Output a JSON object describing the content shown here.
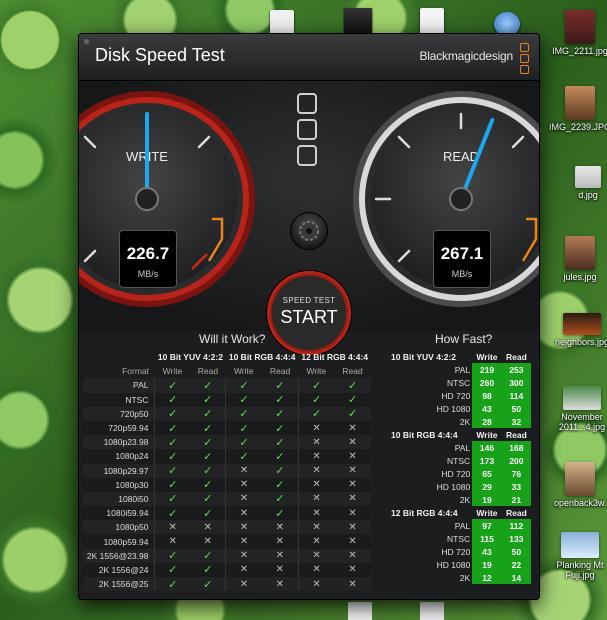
{
  "window": {
    "title": "Disk Speed Test",
    "brand": "Blackmagicdesign",
    "accent": "#e8831c"
  },
  "write_gauge": {
    "label": "WRITE",
    "value": "226.7",
    "unit": "MB/s",
    "needle_fraction": 0.5
  },
  "read_gauge": {
    "label": "READ",
    "value": "267.1",
    "unit": "MB/s",
    "needle_fraction": 0.58
  },
  "start_button": {
    "small": "SPEED TEST",
    "big": "START"
  },
  "will_it_work": {
    "title": "Will it Work?",
    "groups": [
      "10 Bit YUV 4:2:2",
      "10 Bit RGB 4:4:4",
      "12 Bit RGB 4:4:4"
    ],
    "format_header": "Format",
    "write_label": "Write",
    "read_label": "Read",
    "rows": [
      {
        "format": "PAL",
        "checks": [
          1,
          1,
          1,
          1,
          1,
          1
        ]
      },
      {
        "format": "NTSC",
        "checks": [
          1,
          1,
          1,
          1,
          1,
          1
        ]
      },
      {
        "format": "720p50",
        "checks": [
          1,
          1,
          1,
          1,
          1,
          1
        ]
      },
      {
        "format": "720p59.94",
        "checks": [
          1,
          1,
          1,
          1,
          0,
          0
        ]
      },
      {
        "format": "1080p23.98",
        "checks": [
          1,
          1,
          1,
          1,
          0,
          0
        ]
      },
      {
        "format": "1080p24",
        "checks": [
          1,
          1,
          1,
          1,
          0,
          0
        ]
      },
      {
        "format": "1080p29.97",
        "checks": [
          1,
          1,
          0,
          1,
          0,
          0
        ]
      },
      {
        "format": "1080p30",
        "checks": [
          1,
          1,
          0,
          1,
          0,
          0
        ]
      },
      {
        "format": "1080i50",
        "checks": [
          1,
          1,
          0,
          1,
          0,
          0
        ]
      },
      {
        "format": "1080i59.94",
        "checks": [
          1,
          1,
          0,
          1,
          0,
          0
        ]
      },
      {
        "format": "1080p50",
        "checks": [
          0,
          0,
          0,
          0,
          0,
          0
        ]
      },
      {
        "format": "1080p59.94",
        "checks": [
          0,
          0,
          0,
          0,
          0,
          0
        ]
      },
      {
        "format": "2K 1556@23.98",
        "checks": [
          1,
          1,
          0,
          0,
          0,
          0
        ]
      },
      {
        "format": "2K 1556@24",
        "checks": [
          1,
          1,
          0,
          0,
          0,
          0
        ]
      },
      {
        "format": "2K 1556@25",
        "checks": [
          1,
          1,
          0,
          0,
          0,
          0
        ]
      }
    ]
  },
  "how_fast": {
    "title": "How Fast?",
    "write_label": "Write",
    "read_label": "Read",
    "sections": [
      {
        "name": "10 Bit YUV 4:2:2",
        "rows": [
          {
            "format": "PAL",
            "write": "219",
            "read": "253"
          },
          {
            "format": "NTSC",
            "write": "260",
            "read": "300"
          },
          {
            "format": "HD 720",
            "write": "98",
            "read": "114"
          },
          {
            "format": "HD 1080",
            "write": "43",
            "read": "50"
          },
          {
            "format": "2K",
            "write": "28",
            "read": "32"
          }
        ]
      },
      {
        "name": "10 Bit RGB 4:4:4",
        "rows": [
          {
            "format": "PAL",
            "write": "146",
            "read": "168"
          },
          {
            "format": "NTSC",
            "write": "173",
            "read": "200"
          },
          {
            "format": "HD 720",
            "write": "65",
            "read": "76"
          },
          {
            "format": "HD 1080",
            "write": "29",
            "read": "33"
          },
          {
            "format": "2K",
            "write": "19",
            "read": "21"
          }
        ]
      },
      {
        "name": "12 Bit RGB 4:4:4",
        "rows": [
          {
            "format": "PAL",
            "write": "97",
            "read": "112"
          },
          {
            "format": "NTSC",
            "write": "115",
            "read": "133"
          },
          {
            "format": "HD 720",
            "write": "43",
            "read": "50"
          },
          {
            "format": "HD 1080",
            "write": "19",
            "read": "22"
          },
          {
            "format": "2K",
            "write": "12",
            "read": "14"
          }
        ]
      }
    ]
  },
  "desktop_icons": [
    {
      "caption": "IMG_2211.jpg"
    },
    {
      "caption": "IMG_2239.JPG"
    },
    {
      "caption": "d.jpg"
    },
    {
      "caption": "jules.jpg"
    },
    {
      "caption": "neighbors.jpg"
    },
    {
      "caption": "November 2011...4.jpg"
    },
    {
      "caption": "openback3w...y.jpg"
    },
    {
      "caption": "Planking Mt Fuji.jpg"
    }
  ]
}
